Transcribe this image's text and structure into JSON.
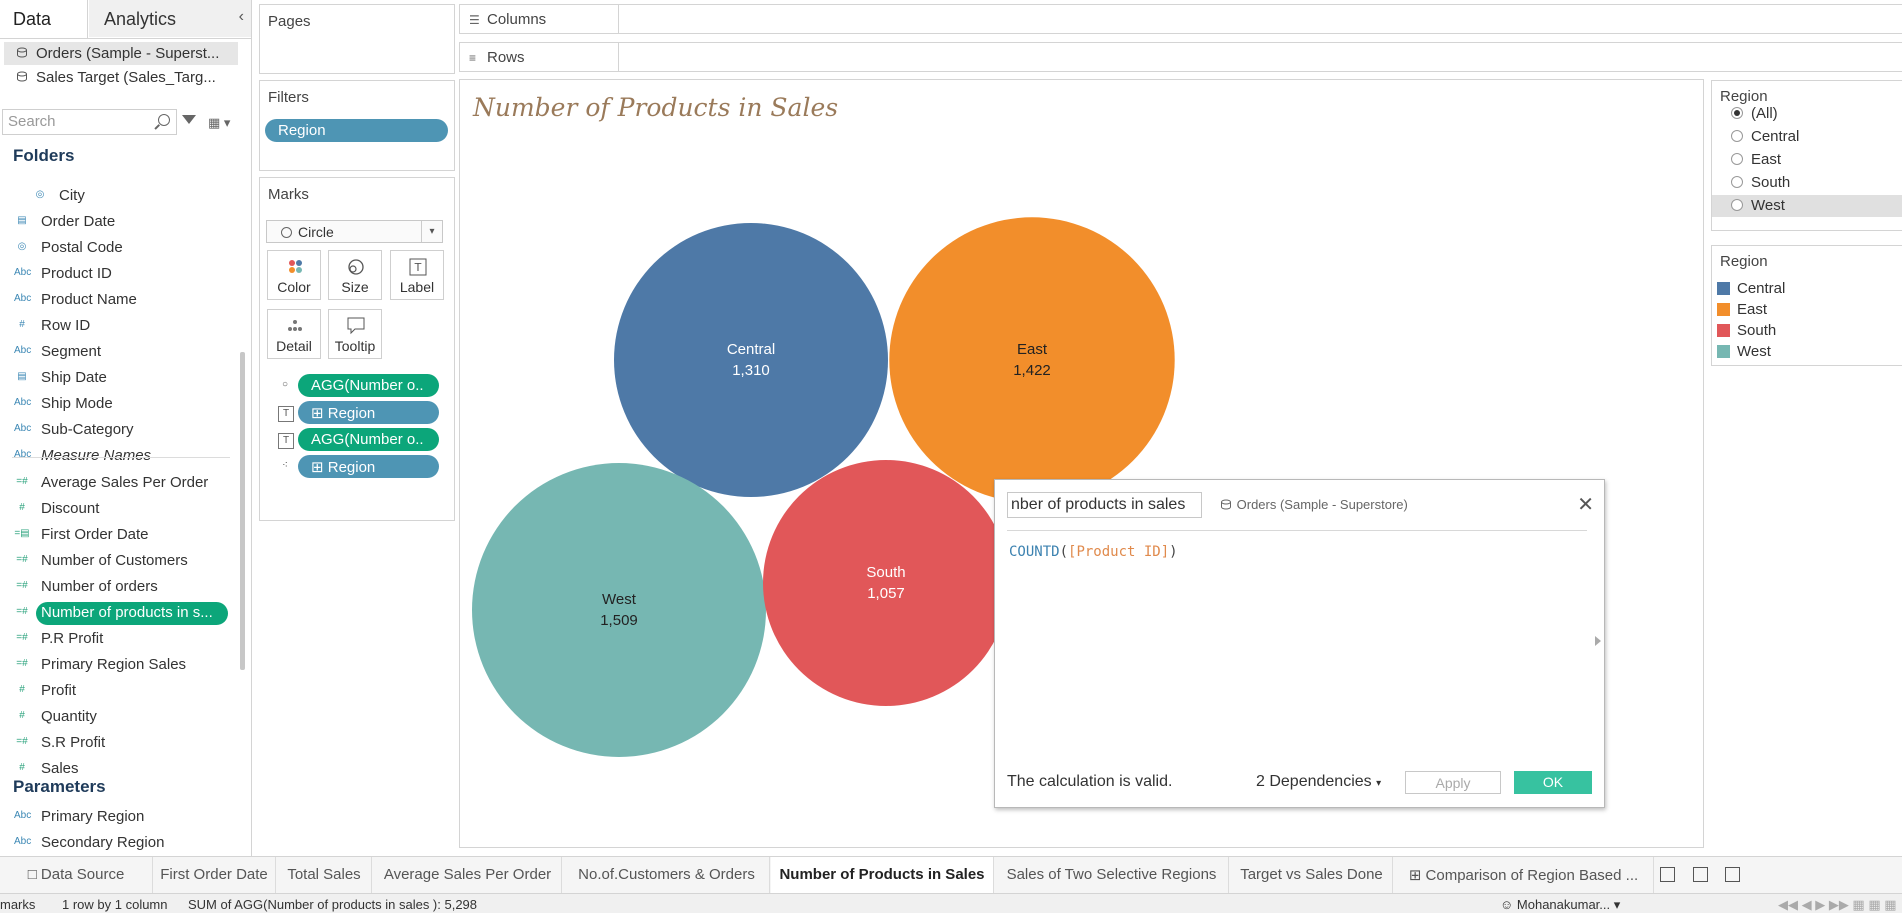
{
  "left_pane": {
    "tabs": [
      "Data",
      "Analytics"
    ],
    "datasources": [
      "Orders (Sample - Superst...",
      "Sales Target (Sales_Targ..."
    ],
    "search_placeholder": "Search",
    "folders_heading": "Folders",
    "fields": [
      {
        "name": "City",
        "icon": "globe-icon",
        "type": "dim"
      },
      {
        "name": "Order Date",
        "icon": "calendar-icon",
        "type": "dim"
      },
      {
        "name": "Postal Code",
        "icon": "globe-icon",
        "type": "dim"
      },
      {
        "name": "Product ID",
        "icon": "abc-icon",
        "type": "dim"
      },
      {
        "name": "Product Name",
        "icon": "abc-icon",
        "type": "dim"
      },
      {
        "name": "Row ID",
        "icon": "hash-icon",
        "type": "dim"
      },
      {
        "name": "Segment",
        "icon": "abc-icon",
        "type": "dim"
      },
      {
        "name": "Ship Date",
        "icon": "calendar-icon",
        "type": "dim"
      },
      {
        "name": "Ship Mode",
        "icon": "abc-icon",
        "type": "dim"
      },
      {
        "name": "Sub-Category",
        "icon": "abc-icon",
        "type": "dim"
      },
      {
        "name": "Measure Names",
        "icon": "abc-icon",
        "type": "dim"
      },
      {
        "name": "Average Sales Per Order",
        "icon": "calc-hash-icon",
        "type": "measure"
      },
      {
        "name": "Discount",
        "icon": "hash-icon",
        "type": "measure"
      },
      {
        "name": "First Order Date",
        "icon": "calc-calendar-icon",
        "type": "measure"
      },
      {
        "name": "Number of Customers",
        "icon": "calc-hash-icon",
        "type": "measure"
      },
      {
        "name": "Number of orders",
        "icon": "calc-hash-icon",
        "type": "measure"
      },
      {
        "name": "Number of products in s...",
        "icon": "calc-hash-icon",
        "type": "measure"
      },
      {
        "name": "P.R Profit",
        "icon": "calc-hash-icon",
        "type": "measure"
      },
      {
        "name": "Primary Region Sales",
        "icon": "calc-hash-icon",
        "type": "measure"
      },
      {
        "name": "Profit",
        "icon": "hash-icon",
        "type": "measure"
      },
      {
        "name": "Quantity",
        "icon": "hash-icon",
        "type": "measure"
      },
      {
        "name": "S.R Profit",
        "icon": "calc-hash-icon",
        "type": "measure"
      },
      {
        "name": "Sales",
        "icon": "hash-icon",
        "type": "measure"
      }
    ],
    "parameters_heading": "Parameters",
    "parameters": [
      {
        "name": "Primary Region",
        "icon": "abc-icon"
      },
      {
        "name": "Secondary Region",
        "icon": "abc-icon"
      }
    ]
  },
  "shelves": {
    "pages_label": "Pages",
    "filters_label": "Filters",
    "filter_pill": "Region",
    "columns_label": "Columns",
    "rows_label": "Rows",
    "marks_label": "Marks",
    "mark_type": "Circle",
    "mark_buttons": [
      "Color",
      "Size",
      "Label",
      "Detail",
      "Tooltip"
    ],
    "mark_pills": [
      {
        "label": "AGG(Number o..",
        "icon": "size-icon",
        "kind": "measure"
      },
      {
        "label": "Region",
        "icon": "label-icon",
        "kind": "dim",
        "plus": true
      },
      {
        "label": "AGG(Number o..",
        "icon": "label-icon",
        "kind": "measure"
      },
      {
        "label": "Region",
        "icon": "color-icon",
        "kind": "dim",
        "plus": true
      }
    ]
  },
  "view": {
    "title": "Number of Products in Sales"
  },
  "chart_data": {
    "type": "bubble",
    "categories": [
      "Central",
      "East",
      "South",
      "West"
    ],
    "values": [
      1310,
      1422,
      1057,
      1509
    ],
    "value_labels": [
      "1,310",
      "1,422",
      "1,057",
      "1,509"
    ],
    "colors": {
      "Central": "#4e79a7",
      "East": "#f28e2b",
      "South": "#e15759",
      "West": "#76b7b2"
    }
  },
  "calc_dialog": {
    "name": "nber of products in sales",
    "source": "Orders (Sample - Superstore)",
    "formula_fn": "COUNTD",
    "formula_open": "(",
    "formula_field": "[Product ID]",
    "formula_close": ")",
    "status": "The calculation is valid.",
    "dependencies": "2 Dependencies",
    "apply_label": "Apply",
    "ok_label": "OK"
  },
  "region_filter": {
    "title": "Region",
    "options": [
      "(All)",
      "Central",
      "East",
      "South",
      "West"
    ],
    "selected": "(All)",
    "hovered": "West"
  },
  "region_legend": {
    "title": "Region",
    "items": [
      "Central",
      "East",
      "South",
      "West"
    ]
  },
  "sheet_tabs": [
    "Data Source",
    "First Order Date",
    "Total Sales",
    "Average Sales Per Order",
    "No.of.Customers & Orders",
    "Number of Products in Sales",
    "Sales of Two Selective Regions",
    "Target vs Sales Done",
    "Comparison of Region Based ..."
  ],
  "active_tab": "Number of Products in Sales",
  "status_bar": {
    "marks": "marks",
    "rows": "1 row by 1 column",
    "sum": "SUM of AGG(Number of products in sales ): 5,298",
    "user": "Mohanakumar..."
  }
}
